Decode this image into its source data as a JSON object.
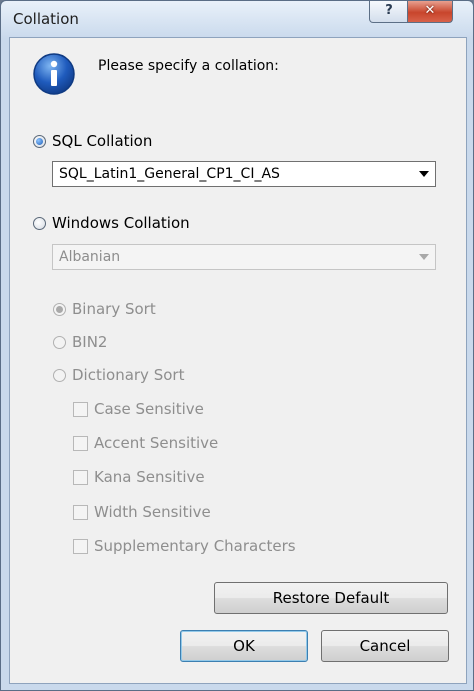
{
  "dialog": {
    "title": "Collation",
    "help_glyph": "?",
    "close_glyph": "✕",
    "prompt": "Please specify a collation:",
    "icon": "info-icon"
  },
  "sql_collation": {
    "label": "SQL Collation",
    "checked": true,
    "selected_value": "SQL_Latin1_General_CP1_CI_AS"
  },
  "windows_collation": {
    "label": "Windows Collation",
    "checked": false,
    "selected_value": "Albanian"
  },
  "sort_options": [
    {
      "label": "Binary Sort",
      "checked": true
    },
    {
      "label": "BIN2",
      "checked": false
    },
    {
      "label": "Dictionary Sort",
      "checked": false
    }
  ],
  "dictionary_options": [
    {
      "label": "Case Sensitive",
      "checked": false
    },
    {
      "label": "Accent Sensitive",
      "checked": false
    },
    {
      "label": "Kana Sensitive",
      "checked": false
    },
    {
      "label": "Width Sensitive",
      "checked": false
    },
    {
      "label": "Supplementary Characters",
      "checked": false
    }
  ],
  "buttons": {
    "restore_default": "Restore Default",
    "ok": "OK",
    "cancel": "Cancel"
  }
}
